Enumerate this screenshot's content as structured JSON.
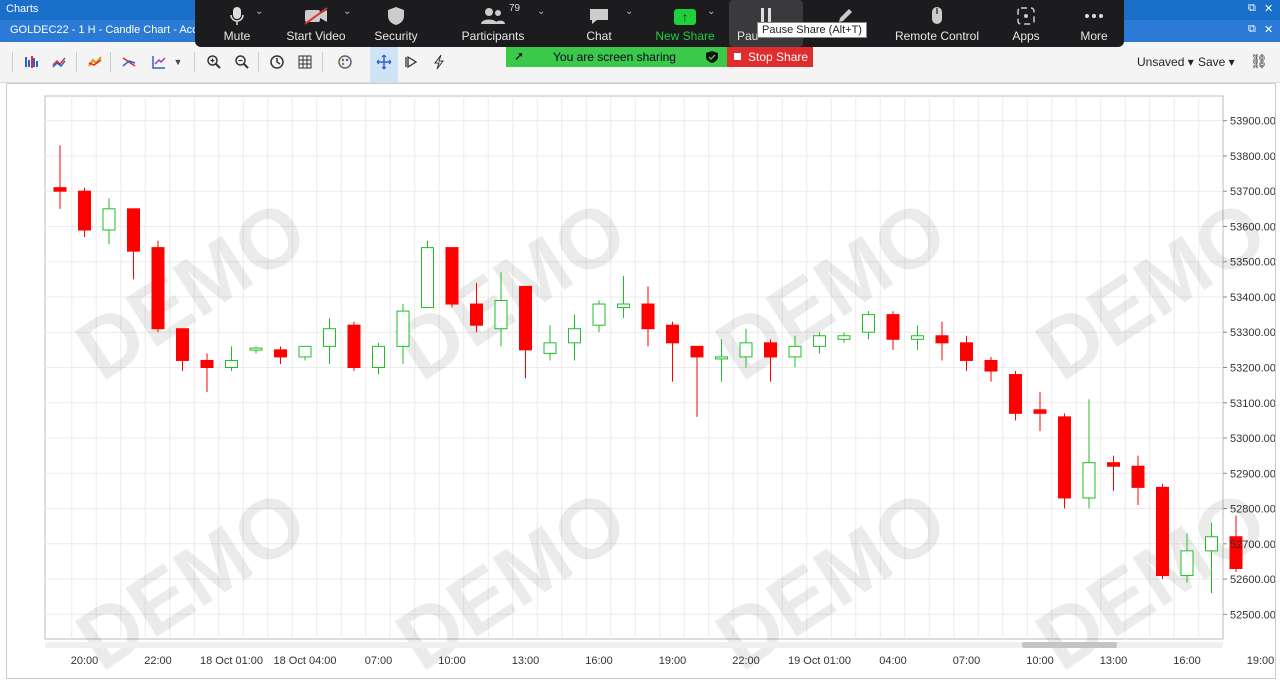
{
  "window": {
    "title": "Charts",
    "ctl_restore": "⧉",
    "ctl_close": "✕"
  },
  "doc_tab": {
    "title": "GOLDEC22 - 1 H - Candle Chart - Accoun",
    "ctl_restore": "⧉",
    "ctl_close": "✕"
  },
  "toolbar": {
    "unsaved_label": "Unsaved ▾",
    "save_label": "Save ▾",
    "link_icon": "⛓"
  },
  "zoom_bar": {
    "mute": "Mute",
    "start_video": "Start Video",
    "security": "Security",
    "participants": "Participants",
    "participants_count": "79",
    "chat": "Chat",
    "new_share": "New Share",
    "pause_share": "Pau",
    "annotate": "Annotate",
    "remote_control": "Remote Control",
    "apps": "Apps",
    "more": "More",
    "tooltip": "Pause Share (Alt+T)"
  },
  "share_banner": {
    "text": "You are screen sharing",
    "stop_label": "Stop Share"
  },
  "chart_data": {
    "type": "candlestick",
    "watermark": "DEMO",
    "up_color": "#1fbf2a",
    "down_color": "#ff0000",
    "ylim": [
      52430,
      53970
    ],
    "y_ticks": [
      "53900.00",
      "53800.00",
      "53700.00",
      "53600.00",
      "53500.00",
      "53400.00",
      "53300.00",
      "53200.00",
      "53100.00",
      "53000.00",
      "52900.00",
      "52800.00",
      "52700.00",
      "52600.00",
      "52500.00"
    ],
    "x_ticks": [
      {
        "i": 1,
        "label": "20:00"
      },
      {
        "i": 4,
        "label": "22:00"
      },
      {
        "i": 7,
        "label": "18 Oct 01:00"
      },
      {
        "i": 10,
        "label": "18 Oct 04:00"
      },
      {
        "i": 13,
        "label": "07:00"
      },
      {
        "i": 16,
        "label": "10:00"
      },
      {
        "i": 19,
        "label": "13:00"
      },
      {
        "i": 22,
        "label": "16:00"
      },
      {
        "i": 25,
        "label": "19:00"
      },
      {
        "i": 28,
        "label": "22:00"
      },
      {
        "i": 31,
        "label": "19 Oct 01:00"
      },
      {
        "i": 34,
        "label": "04:00"
      },
      {
        "i": 37,
        "label": "07:00"
      },
      {
        "i": 40,
        "label": "10:00"
      },
      {
        "i": 43,
        "label": "13:00"
      },
      {
        "i": 46,
        "label": "16:00"
      },
      {
        "i": 49,
        "label": "19:00"
      }
    ],
    "candles": [
      [
        53710,
        53830,
        53650,
        53700
      ],
      [
        53700,
        53710,
        53570,
        53590
      ],
      [
        53590,
        53680,
        53550,
        53650
      ],
      [
        53650,
        53650,
        53450,
        53530
      ],
      [
        53540,
        53560,
        53300,
        53310
      ],
      [
        53310,
        53310,
        53190,
        53220
      ],
      [
        53220,
        53240,
        53130,
        53200
      ],
      [
        53200,
        53260,
        53190,
        53220
      ],
      [
        53250,
        53260,
        53240,
        53255
      ],
      [
        53250,
        53260,
        53210,
        53230
      ],
      [
        53230,
        53260,
        53220,
        53260
      ],
      [
        53260,
        53340,
        53210,
        53310
      ],
      [
        53320,
        53330,
        53190,
        53200
      ],
      [
        53200,
        53270,
        53180,
        53260
      ],
      [
        53260,
        53380,
        53210,
        53360
      ],
      [
        53370,
        53560,
        53370,
        53540
      ],
      [
        53540,
        53540,
        53370,
        53380
      ],
      [
        53380,
        53440,
        53300,
        53320
      ],
      [
        53310,
        53470,
        53260,
        53390
      ],
      [
        53430,
        53430,
        53170,
        53250
      ],
      [
        53240,
        53320,
        53220,
        53270
      ],
      [
        53270,
        53350,
        53220,
        53310
      ],
      [
        53320,
        53390,
        53300,
        53380
      ],
      [
        53370,
        53460,
        53340,
        53380
      ],
      [
        53380,
        53430,
        53260,
        53310
      ],
      [
        53320,
        53330,
        53160,
        53270
      ],
      [
        53260,
        53260,
        53060,
        53230
      ],
      [
        53230,
        53280,
        53160,
        53230
      ],
      [
        53230,
        53310,
        53200,
        53270
      ],
      [
        53270,
        53280,
        53160,
        53230
      ],
      [
        53230,
        53290,
        53200,
        53260
      ],
      [
        53260,
        53300,
        53240,
        53290
      ],
      [
        53280,
        53300,
        53270,
        53290
      ],
      [
        53300,
        53360,
        53280,
        53350
      ],
      [
        53350,
        53360,
        53250,
        53280
      ],
      [
        53280,
        53320,
        53250,
        53290
      ],
      [
        53290,
        53330,
        53220,
        53270
      ],
      [
        53270,
        53290,
        53190,
        53220
      ],
      [
        53220,
        53230,
        53160,
        53190
      ],
      [
        53180,
        53190,
        53050,
        53070
      ],
      [
        53080,
        53130,
        53020,
        53070
      ],
      [
        53060,
        53070,
        52800,
        52830
      ],
      [
        52830,
        53110,
        52800,
        52930
      ],
      [
        52930,
        52950,
        52850,
        52920
      ],
      [
        52920,
        52950,
        52810,
        52860
      ],
      [
        52860,
        52870,
        52600,
        52610
      ],
      [
        52610,
        52730,
        52590,
        52680
      ],
      [
        52680,
        52760,
        52560,
        52720
      ],
      [
        52720,
        52780,
        52620,
        52630
      ]
    ]
  }
}
